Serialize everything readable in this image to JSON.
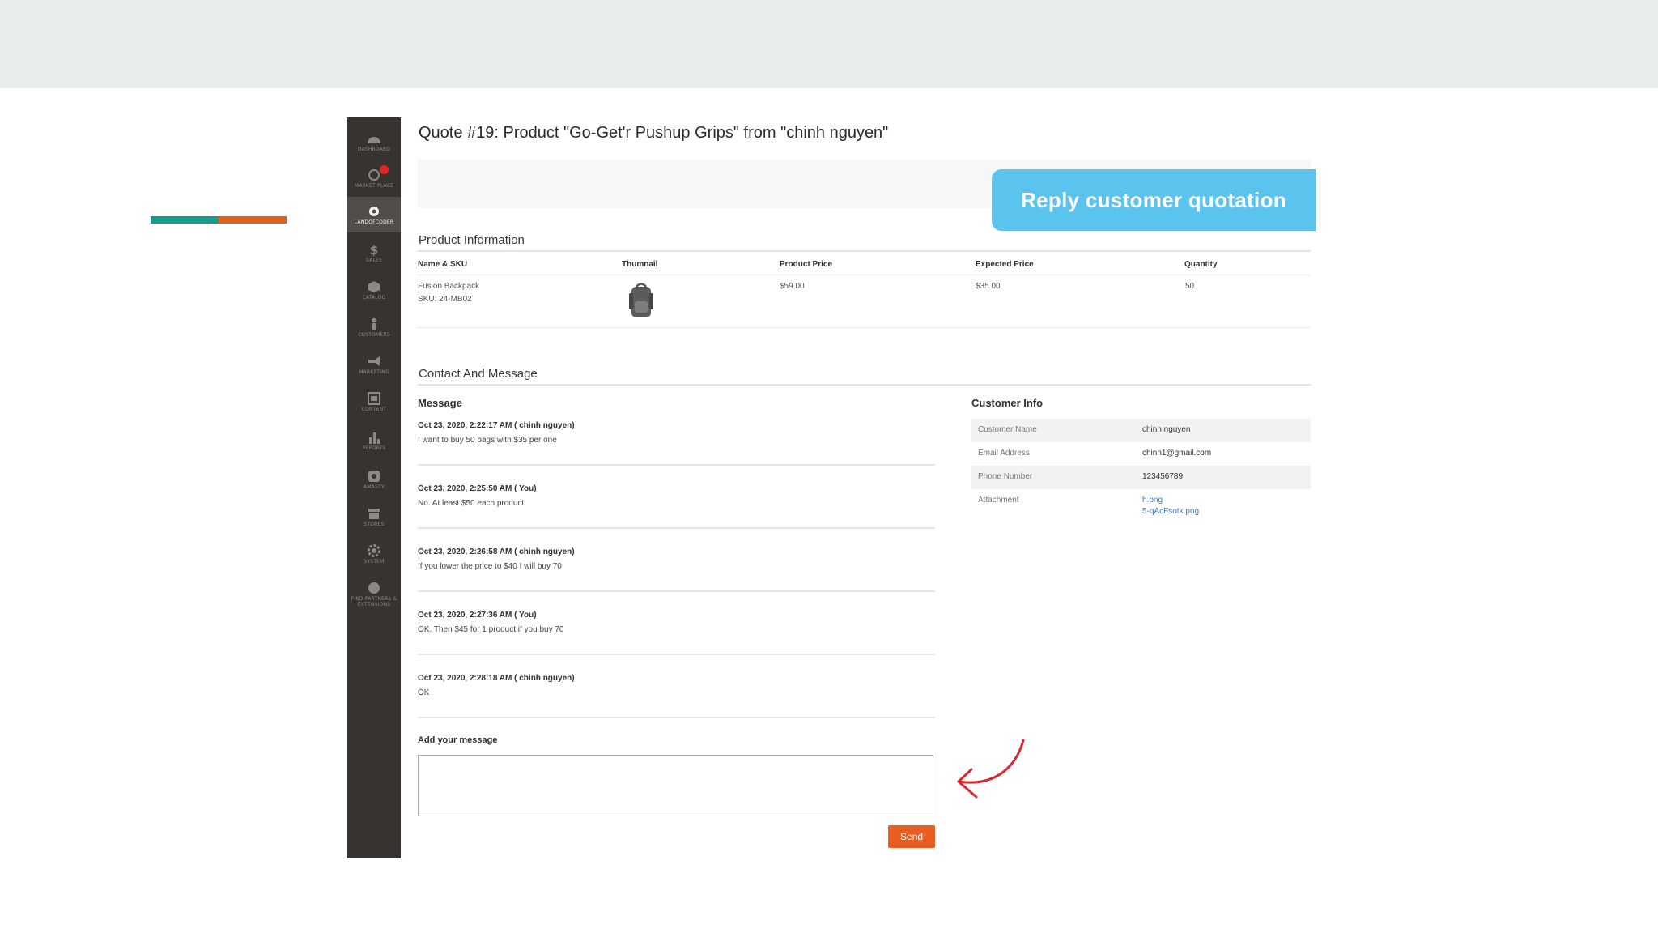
{
  "sidebar": {
    "items": [
      {
        "label": "DASHBOARD",
        "icon": "dashboard-icon",
        "active": false
      },
      {
        "label": "MARKET PLACE",
        "icon": "marketplace-icon",
        "active": false,
        "badge": true
      },
      {
        "label": "LANDOFCODER",
        "icon": "landofcoder-icon",
        "active": true
      },
      {
        "label": "SALES",
        "icon": "dollar-icon",
        "active": false
      },
      {
        "label": "CATALOG",
        "icon": "cube-icon",
        "active": false
      },
      {
        "label": "CUSTOMERS",
        "icon": "person-icon",
        "active": false
      },
      {
        "label": "MARKETING",
        "icon": "megaphone-icon",
        "active": false
      },
      {
        "label": "CONTENT",
        "icon": "content-icon",
        "active": false
      },
      {
        "label": "REPORTS",
        "icon": "bar-chart-icon",
        "active": false
      },
      {
        "label": "AMASTY",
        "icon": "amasty-icon",
        "active": false
      },
      {
        "label": "STORES",
        "icon": "store-icon",
        "active": false
      },
      {
        "label": "SYSTEM",
        "icon": "gear-icon",
        "active": false
      },
      {
        "label": "FIND PARTNERS & EXTENSIONS",
        "icon": "partners-icon",
        "active": false
      }
    ]
  },
  "page": {
    "title": "Quote #19: Product \"Go-Get'r Pushup Grips\" from \"chinh nguyen\"",
    "reply_button": "Reply customer quotation"
  },
  "product_info": {
    "title": "Product Information",
    "headers": {
      "name": "Name & SKU",
      "thumbnail": "Thumnail",
      "price": "Product Price",
      "expected": "Expected Price",
      "qty": "Quantity"
    },
    "row": {
      "name": "Fusion Backpack",
      "sku": "SKU: 24-MB02",
      "price": "$59.00",
      "expected": "$35.00",
      "qty": "50"
    }
  },
  "contact": {
    "title": "Contact And Message",
    "message_heading": "Message",
    "messages": [
      {
        "meta": "Oct 23, 2020, 2:22:17 AM ( chinh nguyen)",
        "text": "I want to buy 50 bags with $35 per one"
      },
      {
        "meta": "Oct 23, 2020, 2:25:50 AM ( You)",
        "text": "No. At least $50 each product"
      },
      {
        "meta": "Oct 23, 2020, 2:26:58 AM ( chinh nguyen)",
        "text": "If you lower the price to $40 I will buy 70"
      },
      {
        "meta": "Oct 23, 2020, 2:27:36 AM ( You)",
        "text": "OK. Then $45 for 1 product if you buy 70"
      },
      {
        "meta": "Oct 23, 2020, 2:28:18 AM ( chinh nguyen)",
        "text": "OK"
      }
    ],
    "add_message_label": "Add your message",
    "message_value": "",
    "send_label": "Send"
  },
  "customer_info": {
    "heading": "Customer Info",
    "rows": [
      {
        "label": "Customer Name",
        "value": "chinh nguyen"
      },
      {
        "label": "Email Address",
        "value": "chinh1@gmail.com"
      },
      {
        "label": "Phone Number",
        "value": "123456789"
      },
      {
        "label": "Attachment",
        "value": ""
      }
    ],
    "attachments": [
      "h.png",
      "5-qAcFsotk.png"
    ]
  },
  "colors": {
    "sidebar": "#373330",
    "reply_button": "#5ac4ee",
    "send_button": "#e85d22",
    "accent_teal": "#1a9a8c",
    "accent_orange": "#e0601e",
    "annotation_arrow": "#d9282f"
  }
}
